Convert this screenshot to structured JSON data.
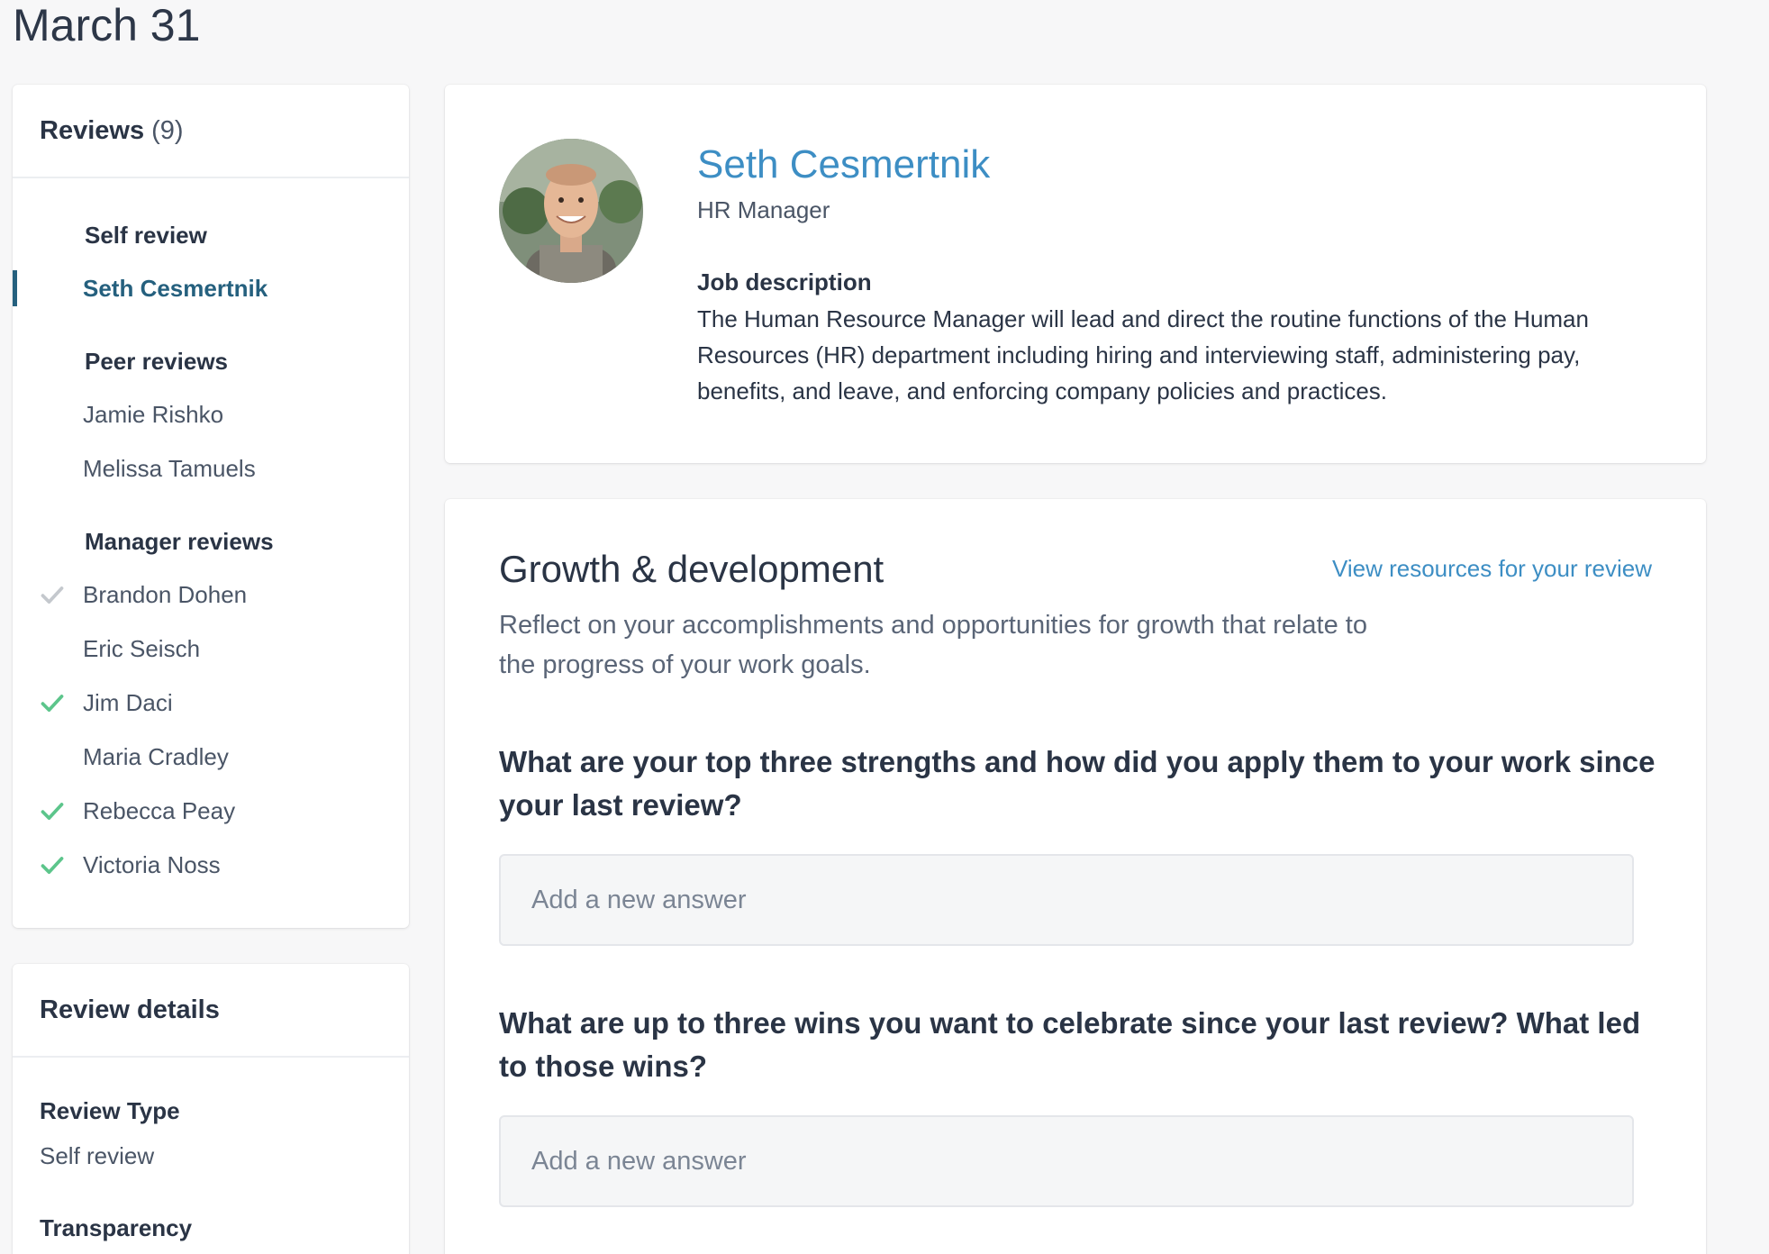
{
  "page": {
    "date_title": "March 31"
  },
  "reviews": {
    "title": "Reviews",
    "count": "(9)",
    "self_heading": "Self review",
    "self_items": [
      {
        "name": "Seth Cesmertnik",
        "active": true,
        "completed": false
      }
    ],
    "peer_heading": "Peer reviews",
    "peer_items": [
      {
        "name": "Jamie Rishko",
        "completed": false
      },
      {
        "name": "Melissa Tamuels",
        "completed": false
      }
    ],
    "manager_heading": "Manager reviews",
    "manager_items": [
      {
        "name": "Brandon Dohen",
        "status": "check-gray"
      },
      {
        "name": "Eric Seisch",
        "status": "none"
      },
      {
        "name": "Jim Daci",
        "status": "check-green"
      },
      {
        "name": "Maria Cradley",
        "status": "none"
      },
      {
        "name": "Rebecca Peay",
        "status": "check-green"
      },
      {
        "name": "Victoria Noss",
        "status": "check-green"
      }
    ]
  },
  "details": {
    "title": "Review details",
    "review_type_label": "Review Type",
    "review_type_value": "Self review",
    "transparency_label": "Transparency"
  },
  "profile": {
    "name": "Seth Cesmertnik",
    "role": "HR Manager",
    "job_label": "Job description",
    "job_text": "The Human Resource Manager will lead and direct the routine functions of the Human Resources (HR) department including hiring and interviewing staff, administering pay, benefits, and leave, and enforcing company policies and practices."
  },
  "growth": {
    "title": "Growth & development",
    "resources_link": "View resources for your review",
    "description": "Reflect on your accomplishments and opportunities for growth that relate to the progress of your work goals.",
    "questions": [
      {
        "text": "What are your top three strengths and how did you apply them to your work since your last review?",
        "placeholder": "Add a new answer"
      },
      {
        "text": "What are up to three wins you want to celebrate since your last review? What led to those wins?",
        "placeholder": "Add a new answer"
      }
    ]
  },
  "colors": {
    "accent": "#3d8ec4",
    "active_nav": "#25607e",
    "check_green": "#5cc58b",
    "check_gray": "#c4c8cd"
  }
}
